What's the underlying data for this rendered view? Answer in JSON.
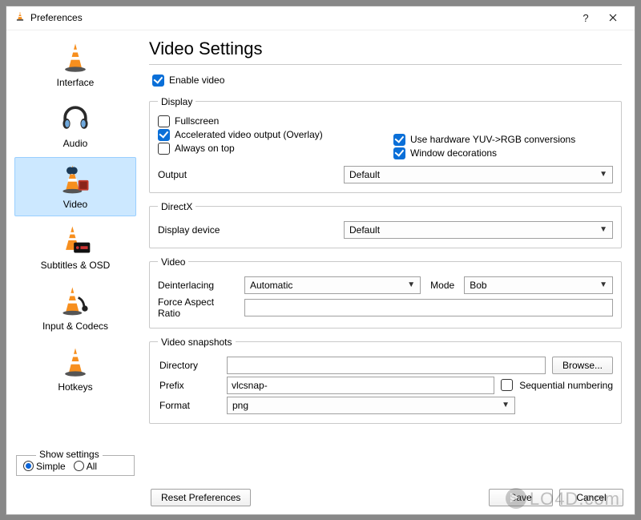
{
  "window": {
    "title": "Preferences"
  },
  "sidebar": {
    "items": [
      {
        "label": "Interface"
      },
      {
        "label": "Audio"
      },
      {
        "label": "Video"
      },
      {
        "label": "Subtitles & OSD"
      },
      {
        "label": "Input & Codecs"
      },
      {
        "label": "Hotkeys"
      }
    ],
    "selected_index": 2
  },
  "show_settings": {
    "legend": "Show settings",
    "simple": "Simple",
    "all": "All",
    "selected": "simple"
  },
  "page": {
    "heading": "Video Settings",
    "enable_video": {
      "label": "Enable video",
      "checked": true
    },
    "display": {
      "legend": "Display",
      "fullscreen": {
        "label": "Fullscreen",
        "checked": false
      },
      "accel": {
        "label": "Accelerated video output (Overlay)",
        "checked": true
      },
      "yuv": {
        "label": "Use hardware YUV->RGB conversions",
        "checked": true
      },
      "always_on_top": {
        "label": "Always on top",
        "checked": false
      },
      "window_decorations": {
        "label": "Window decorations",
        "checked": true
      },
      "output_label": "Output",
      "output_value": "Default"
    },
    "directx": {
      "legend": "DirectX",
      "display_device_label": "Display device",
      "display_device_value": "Default"
    },
    "video": {
      "legend": "Video",
      "deinterlacing_label": "Deinterlacing",
      "deinterlacing_value": "Automatic",
      "mode_label": "Mode",
      "mode_value": "Bob",
      "force_aspect_label": "Force Aspect Ratio",
      "force_aspect_value": ""
    },
    "snapshots": {
      "legend": "Video snapshots",
      "directory_label": "Directory",
      "directory_value": "",
      "browse": "Browse...",
      "prefix_label": "Prefix",
      "prefix_value": "vlcsnap-",
      "seq_label": "Sequential numbering",
      "seq_checked": false,
      "format_label": "Format",
      "format_value": "png"
    }
  },
  "buttons": {
    "reset": "Reset Preferences",
    "save": "Save",
    "cancel": "Cancel"
  },
  "watermark": "LO4D.com"
}
